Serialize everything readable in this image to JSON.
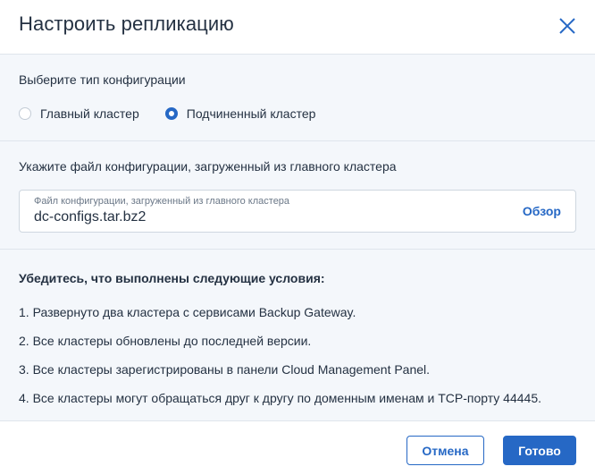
{
  "dialog": {
    "title": "Настроить репликацию"
  },
  "config_type": {
    "label": "Выберите тип конфигурации",
    "options": [
      {
        "label": "Главный кластер",
        "selected": false
      },
      {
        "label": "Подчиненный кластер",
        "selected": true
      }
    ]
  },
  "config_file": {
    "instruction": "Укажите файл конфигурации, загруженный из главного кластера",
    "field_label": "Файл конфигурации, загруженный из главного кластера",
    "value": "dc-configs.tar.bz2",
    "browse_label": "Обзор"
  },
  "conditions": {
    "title": "Убедитесь, что выполнены следующие условия:",
    "items": [
      "1. Развернуто два кластера с сервисами Backup Gateway.",
      "2. Все кластеры обновлены до последней версии.",
      "3. Все кластеры зарегистрированы в панели Cloud Management Panel.",
      "4. Все кластеры могут обращаться друг к другу по доменным именам и TCP-порту 44445."
    ]
  },
  "footer": {
    "cancel_label": "Отмена",
    "done_label": "Готово"
  },
  "colors": {
    "accent": "#2668c5",
    "body_bg": "#f4f7fb",
    "text": "#243142"
  }
}
